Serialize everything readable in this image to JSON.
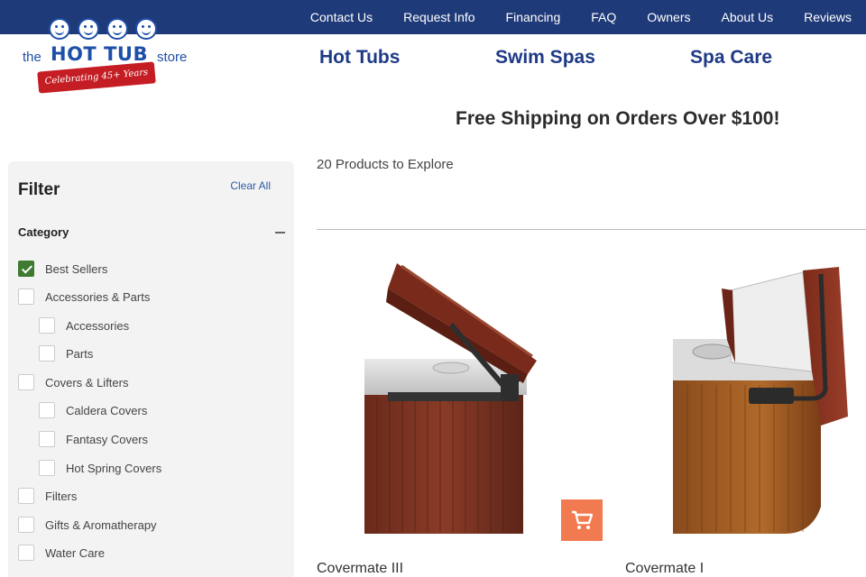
{
  "topnav": [
    "Contact Us",
    "Request Info",
    "Financing",
    "FAQ",
    "Owners",
    "About Us",
    "Reviews"
  ],
  "logo": {
    "the": "the",
    "brand": "HOT TUB",
    "store": "store",
    "tagline": "Celebrating 45+ Years"
  },
  "mainnav": [
    "Hot Tubs",
    "Swim Spas",
    "Spa Care"
  ],
  "promo": "Free Shipping on Orders Over $100!",
  "filter": {
    "title": "Filter",
    "clear_all": "Clear All",
    "category_title": "Category",
    "options": [
      {
        "label": "Best Sellers",
        "checked": true
      },
      {
        "label": "Accessories & Parts",
        "checked": false
      },
      {
        "label": "Accessories",
        "checked": false
      },
      {
        "label": "Parts",
        "checked": false
      },
      {
        "label": "Covers & Lifters",
        "checked": false
      },
      {
        "label": "Caldera Covers",
        "checked": false
      },
      {
        "label": "Fantasy Covers",
        "checked": false
      },
      {
        "label": "Hot Spring Covers",
        "checked": false
      },
      {
        "label": "Filters",
        "checked": false
      },
      {
        "label": "Gifts & Aromatherapy",
        "checked": false
      },
      {
        "label": "Water Care",
        "checked": false
      }
    ]
  },
  "results_count": "20 Products to Explore",
  "products": [
    {
      "name": "Covermate III"
    },
    {
      "name": "Covermate I"
    }
  ],
  "colors": {
    "nav_bg": "#1f3a78",
    "brand_blue": "#1e3a86",
    "checkbox_green": "#3e7a2f",
    "cart_orange": "#f27a50"
  },
  "icons": {
    "cart": "shopping-cart-icon",
    "check": "checkmark-icon"
  }
}
